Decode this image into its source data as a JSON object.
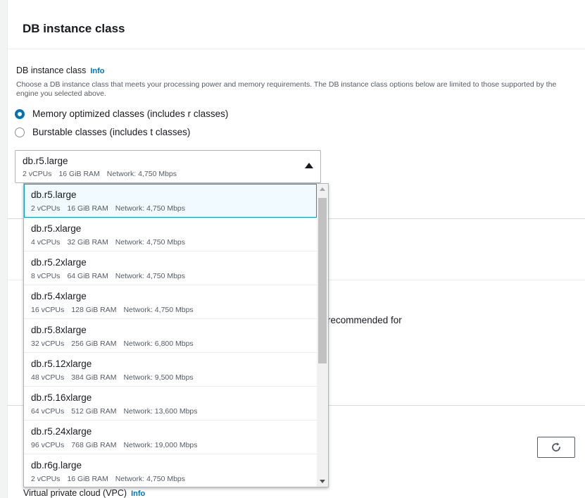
{
  "section": {
    "title": "DB instance class",
    "field_label": "DB instance class",
    "info_link": "Info",
    "description": "Choose a DB instance class that meets your processing power and memory requirements. The DB instance class options below are limited to those supported by the engine you selected above."
  },
  "radio_options": [
    {
      "label": "Memory optimized classes (includes r classes)",
      "checked": true
    },
    {
      "label": "Burstable classes (includes t classes)",
      "checked": false
    }
  ],
  "select": {
    "name": "db.r5.large",
    "vcpus": "2 vCPUs",
    "ram": "16 GiB RAM",
    "network": "Network: 4,750 Mbps"
  },
  "dropdown_options": [
    {
      "name": "db.r5.large",
      "vcpus": "2 vCPUs",
      "ram": "16 GiB RAM",
      "network": "Network: 4,750 Mbps"
    },
    {
      "name": "db.r5.xlarge",
      "vcpus": "4 vCPUs",
      "ram": "32 GiB RAM",
      "network": "Network: 4,750 Mbps"
    },
    {
      "name": "db.r5.2xlarge",
      "vcpus": "8 vCPUs",
      "ram": "64 GiB RAM",
      "network": "Network: 4,750 Mbps"
    },
    {
      "name": "db.r5.4xlarge",
      "vcpus": "16 vCPUs",
      "ram": "128 GiB RAM",
      "network": "Network: 4,750 Mbps"
    },
    {
      "name": "db.r5.8xlarge",
      "vcpus": "32 vCPUs",
      "ram": "256 GiB RAM",
      "network": "Network: 6,800 Mbps"
    },
    {
      "name": "db.r5.12xlarge",
      "vcpus": "48 vCPUs",
      "ram": "384 GiB RAM",
      "network": "Network: 9,500 Mbps"
    },
    {
      "name": "db.r5.16xlarge",
      "vcpus": "64 vCPUs",
      "ram": "512 GiB RAM",
      "network": "Network: 13,600 Mbps"
    },
    {
      "name": "db.r5.24xlarge",
      "vcpus": "96 vCPUs",
      "ram": "768 GiB RAM",
      "network": "Network: 19,000 Mbps"
    },
    {
      "name": "db.r6g.large",
      "vcpus": "2 vCPUs",
      "ram": "16 GiB RAM",
      "network": "Network: 4,750 Mbps"
    }
  ],
  "background": {
    "partial_text": "recommended for",
    "vpc_label": "Virtual private cloud (VPC)",
    "vpc_info": "Info"
  },
  "icons": {
    "refresh": "refresh-icon",
    "caret": "caret-up-icon"
  },
  "colors": {
    "accent": "#0073bb",
    "selected_border": "#00a1c9",
    "selected_bg": "#f1faff"
  }
}
